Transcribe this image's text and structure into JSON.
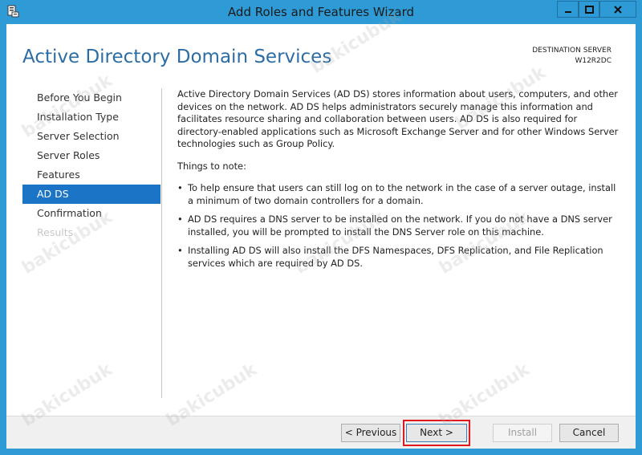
{
  "window": {
    "title": "Add Roles and Features Wizard"
  },
  "header": {
    "page_title": "Active Directory Domain Services",
    "destination_label": "DESTINATION SERVER",
    "destination_server": "W12R2DC"
  },
  "nav": {
    "items": [
      {
        "label": "Before You Begin",
        "state": "normal"
      },
      {
        "label": "Installation Type",
        "state": "normal"
      },
      {
        "label": "Server Selection",
        "state": "normal"
      },
      {
        "label": "Server Roles",
        "state": "normal"
      },
      {
        "label": "Features",
        "state": "normal"
      },
      {
        "label": "AD DS",
        "state": "active"
      },
      {
        "label": "Confirmation",
        "state": "normal"
      },
      {
        "label": "Results",
        "state": "disabled"
      }
    ]
  },
  "content": {
    "intro": "Active Directory Domain Services (AD DS) stores information about users, computers, and other devices on the network.  AD DS helps administrators securely manage this information and facilitates resource sharing and collaboration between users.  AD DS is also required for directory-enabled applications such as Microsoft Exchange Server and for other Windows Server technologies such as Group Policy.",
    "notes_heading": "Things to note:",
    "bullet_char": "•",
    "notes": [
      "To help ensure that users can still log on to the network in the case of a server outage, install a minimum of two domain controllers for a domain.",
      "AD DS requires a DNS server to be installed on the network.  If you do not have a DNS server installed, you will be prompted to install the DNS Server role on this machine.",
      "Installing AD DS will also install the DFS Namespaces, DFS Replication, and File Replication services which are required by AD DS."
    ]
  },
  "footer": {
    "previous_label": "< Previous",
    "next_label": "Next >",
    "install_label": "Install",
    "cancel_label": "Cancel"
  },
  "watermark": "bakicubuk",
  "colors": {
    "titlebar": "#2f9bd6",
    "page_title": "#2d6da3",
    "nav_active": "#1b74c5",
    "highlight": "#e0191f"
  }
}
